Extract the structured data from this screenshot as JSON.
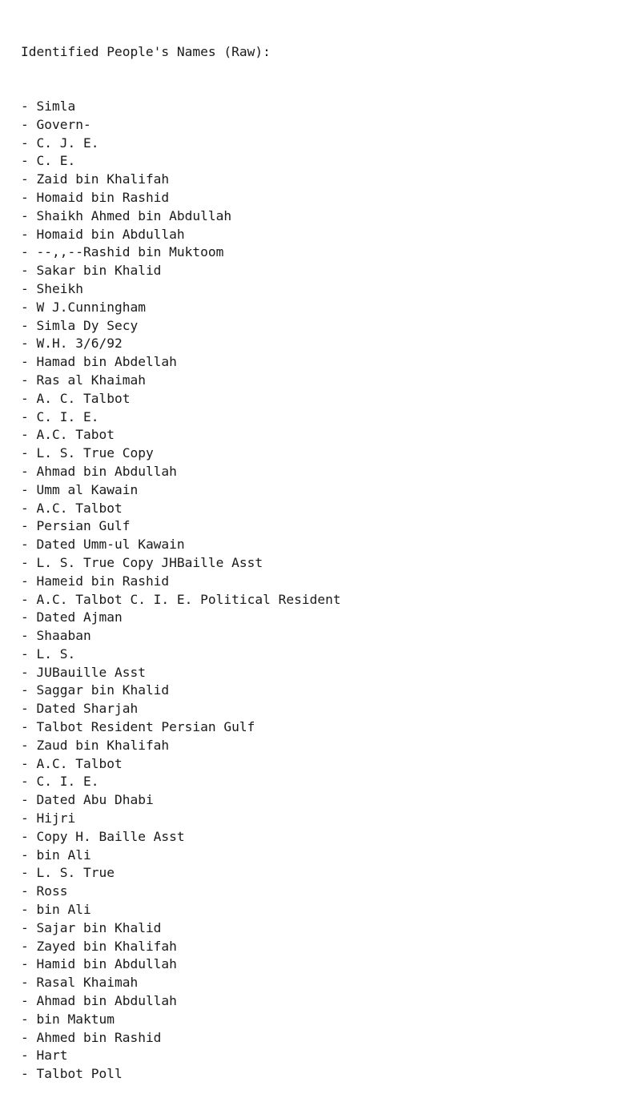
{
  "heading": "Identified People's Names (Raw):",
  "bullet": "- ",
  "names": [
    "Simla",
    "Govern-",
    "C. J. E.",
    "C. E.",
    "Zaid bin Khalifah",
    "Homaid bin Rashid",
    "Shaikh Ahmed bin Abdullah",
    "Homaid bin Abdullah",
    "--,,--Rashid bin Muktoom",
    "Sakar bin Khalid",
    "Sheikh",
    "W J.Cunningham",
    "Simla Dy Secy",
    "W.H. 3/6/92",
    "Hamad bin Abdellah",
    "Ras al Khaimah",
    "A. C. Talbot",
    "C. I. E.",
    "A.C. Tabot",
    "L. S. True Copy",
    "Ahmad bin Abdullah",
    "Umm al Kawain",
    "A.C. Talbot",
    "Persian Gulf",
    "Dated Umm-ul Kawain",
    "L. S. True Copy JHBaille Asst",
    "Hameid bin Rashid",
    "A.C. Talbot C. I. E. Political Resident",
    "Dated Ajman",
    "Shaaban",
    "L. S.",
    "JUBauille Asst",
    "Saggar bin Khalid",
    "Dated Sharjah",
    "Talbot Resident Persian Gulf",
    "Zaud bin Khalifah",
    "A.C. Talbot",
    "C. I. E.",
    "Dated Abu Dhabi",
    "Hijri",
    "Copy H. Baille Asst",
    "bin Ali",
    "L. S. True",
    "Ross",
    "bin Ali",
    "Sajar bin Khalid",
    "Zayed bin Khalifah",
    "Hamid bin Abdullah",
    "Rasal Khaimah",
    "Ahmad bin Abdullah",
    "bin Maktum",
    "Ahmed bin Rashid",
    "Hart",
    "Talbot Poll"
  ]
}
